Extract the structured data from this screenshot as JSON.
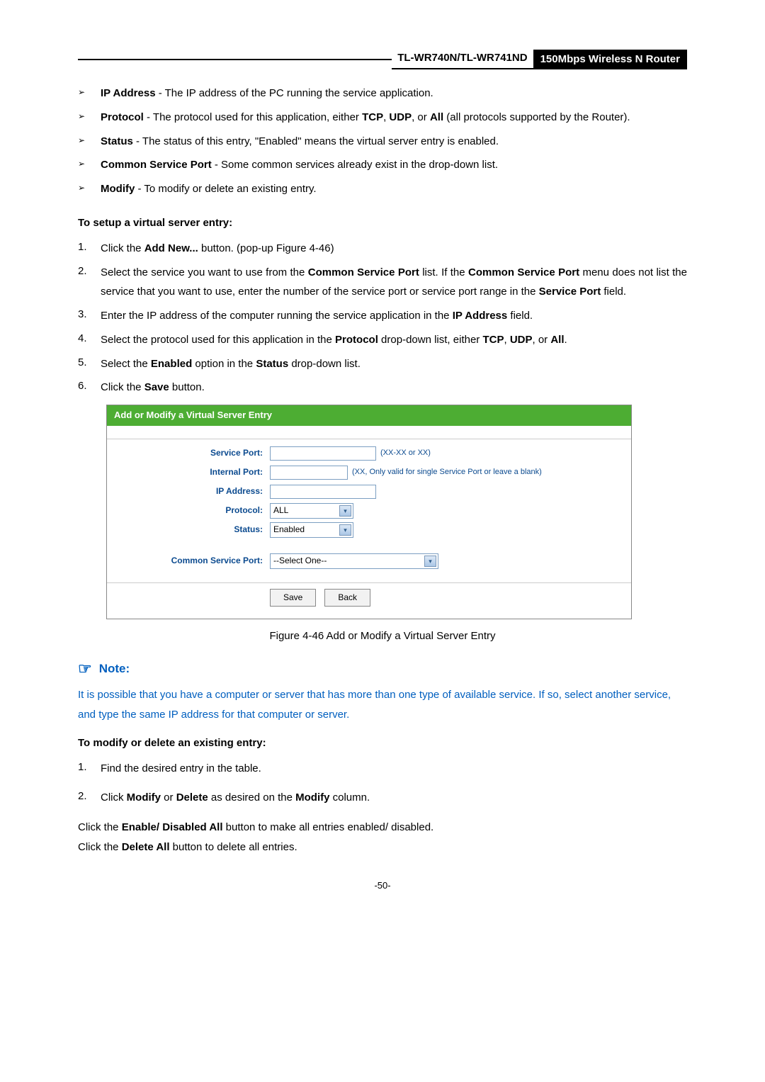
{
  "header": {
    "model": "TL-WR740N/TL-WR741ND",
    "product": "150Mbps Wireless N Router"
  },
  "bullets": {
    "ip_address_label": "IP Address",
    "ip_address_text": " - The IP address of the PC running the service application.",
    "protocol_label": "Protocol",
    "protocol_text_1": " - The protocol used for this application, either ",
    "protocol_tcp": "TCP",
    "protocol_sep1": ", ",
    "protocol_udp": "UDP",
    "protocol_sep2": ", or ",
    "protocol_all": "All",
    "protocol_text_2": " (all protocols supported by the Router).",
    "status_label": "Status",
    "status_text": " - The status of this entry, \"Enabled\" means the virtual server entry is enabled.",
    "common_label": "Common Service Port",
    "common_text": " - Some common services already exist in the drop-down list.",
    "modify_label": "Modify",
    "modify_text": " - To modify or delete an existing entry."
  },
  "setup": {
    "heading": "To setup a virtual server entry:",
    "n1_a": "Click the ",
    "n1_b": "Add New...",
    "n1_c": " button. (pop-up Figure 4-46)",
    "n2_a": "Select the service you want to use from the ",
    "n2_b": "Common Service Port",
    "n2_c": " list. If the ",
    "n2_d": "Common Service Port",
    "n2_e": " menu does not list the service that you want to use, enter the number of the service port or service port range in the ",
    "n2_f": "Service Port",
    "n2_g": " field.",
    "n3_a": "Enter the IP address of the computer running the service application in the ",
    "n3_b": "IP Address",
    "n3_c": " field.",
    "n4_a": "Select the protocol used for this application in the ",
    "n4_b": "Protocol",
    "n4_c": " drop-down list, either ",
    "n4_d": "TCP",
    "n4_e": ", ",
    "n4_f": "UDP",
    "n4_g": ", or ",
    "n4_h": "All",
    "n4_i": ".",
    "n5_a": "Select the ",
    "n5_b": "Enabled",
    "n5_c": " option in the ",
    "n5_d": "Status",
    "n5_e": " drop-down list.",
    "n6_a": "Click the ",
    "n6_b": "Save",
    "n6_c": " button."
  },
  "figure": {
    "title": "Add or Modify a Virtual Server Entry",
    "labels": {
      "service_port": "Service Port:",
      "internal_port": "Internal Port:",
      "ip_address": "IP Address:",
      "protocol": "Protocol:",
      "status": "Status:",
      "common": "Common Service Port:"
    },
    "hints": {
      "service_port": "(XX-XX or XX)",
      "internal_port": "(XX, Only valid for single Service Port or leave a blank)"
    },
    "selects": {
      "protocol": "ALL",
      "status": "Enabled",
      "common": "--Select One--"
    },
    "buttons": {
      "save": "Save",
      "back": "Back"
    },
    "caption": "Figure 4-46    Add or Modify a Virtual Server Entry"
  },
  "note": {
    "label": "Note:",
    "text": "It is possible that you have a computer or server that has more than one type of available service. If so, select another service, and type the same IP address for that computer or server."
  },
  "modify": {
    "heading": "To modify or delete an existing entry:",
    "n1": "Find the desired entry in the table.",
    "n2_a": "Click ",
    "n2_b": "Modify",
    "n2_c": " or ",
    "n2_d": "Delete",
    "n2_e": " as desired on the ",
    "n2_f": "Modify",
    "n2_g": " column."
  },
  "footer": {
    "line1_a": "Click the ",
    "line1_b": "Enable/ Disabled All",
    "line1_c": " button to make all entries enabled/ disabled.",
    "line2_a": "Click the ",
    "line2_b": "Delete All",
    "line2_c": " button to delete all entries."
  },
  "pagenum": "-50-"
}
